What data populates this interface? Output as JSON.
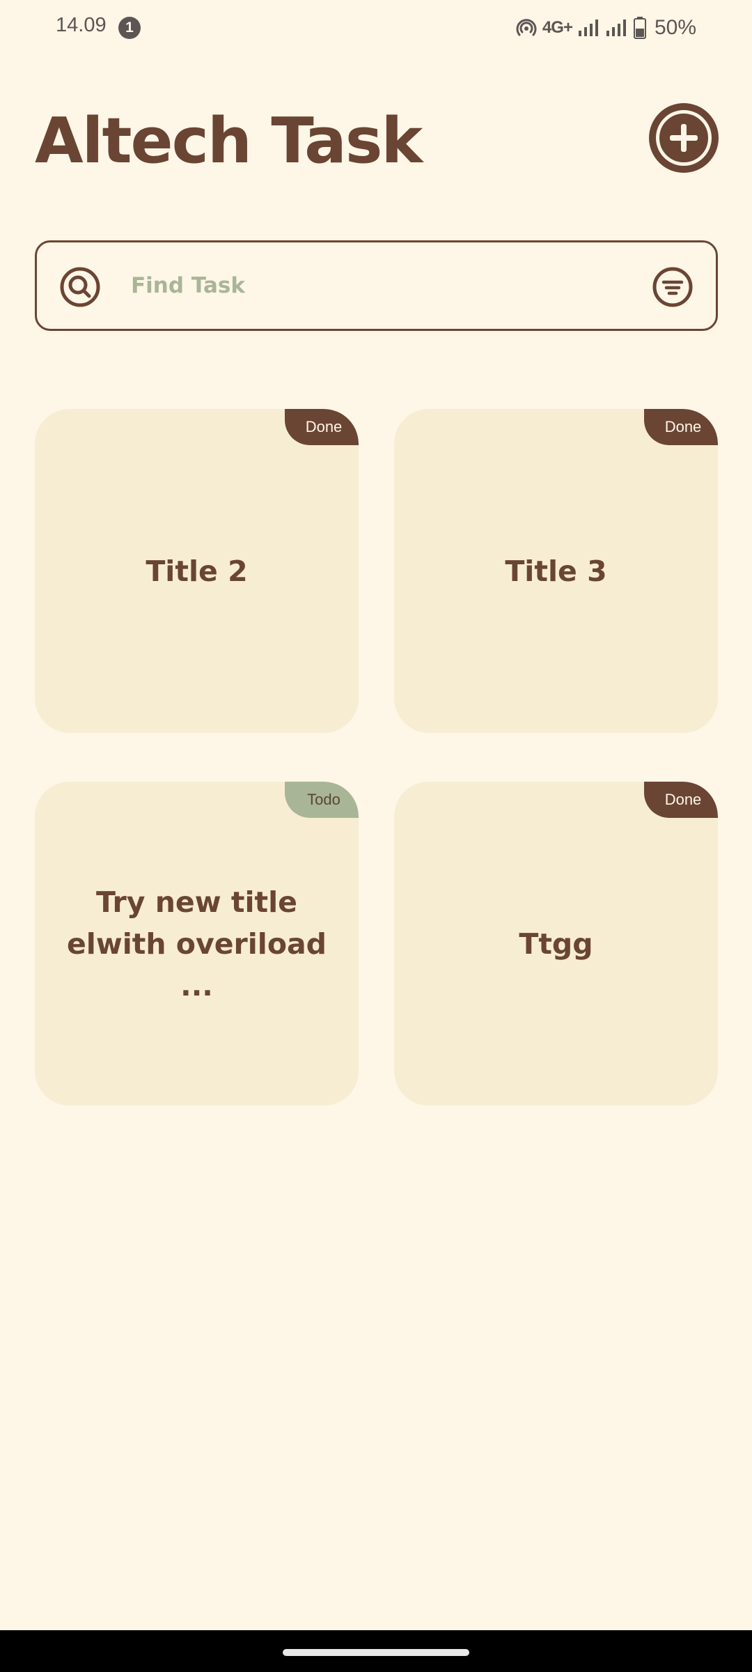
{
  "status_bar": {
    "time": "14.09",
    "notification_count": "1",
    "network": "4G+",
    "battery": "50%"
  },
  "header": {
    "title": "Altech Task"
  },
  "search": {
    "placeholder": "Find Task"
  },
  "tasks": [
    {
      "title": "Title 2",
      "status": "Done"
    },
    {
      "title": "Title 3",
      "status": "Done"
    },
    {
      "title": "Try new title elwith overiload ...",
      "status": "Todo"
    },
    {
      "title": "Ttgg",
      "status": "Done"
    }
  ],
  "colors": {
    "background": "#FEF6E7",
    "card": "#F7EDD3",
    "brown": "#6A4534",
    "sage": "#A9B597"
  },
  "icons": [
    "add-icon",
    "search-icon",
    "filter-icon",
    "hotspot-icon",
    "signal-icon",
    "battery-icon"
  ]
}
